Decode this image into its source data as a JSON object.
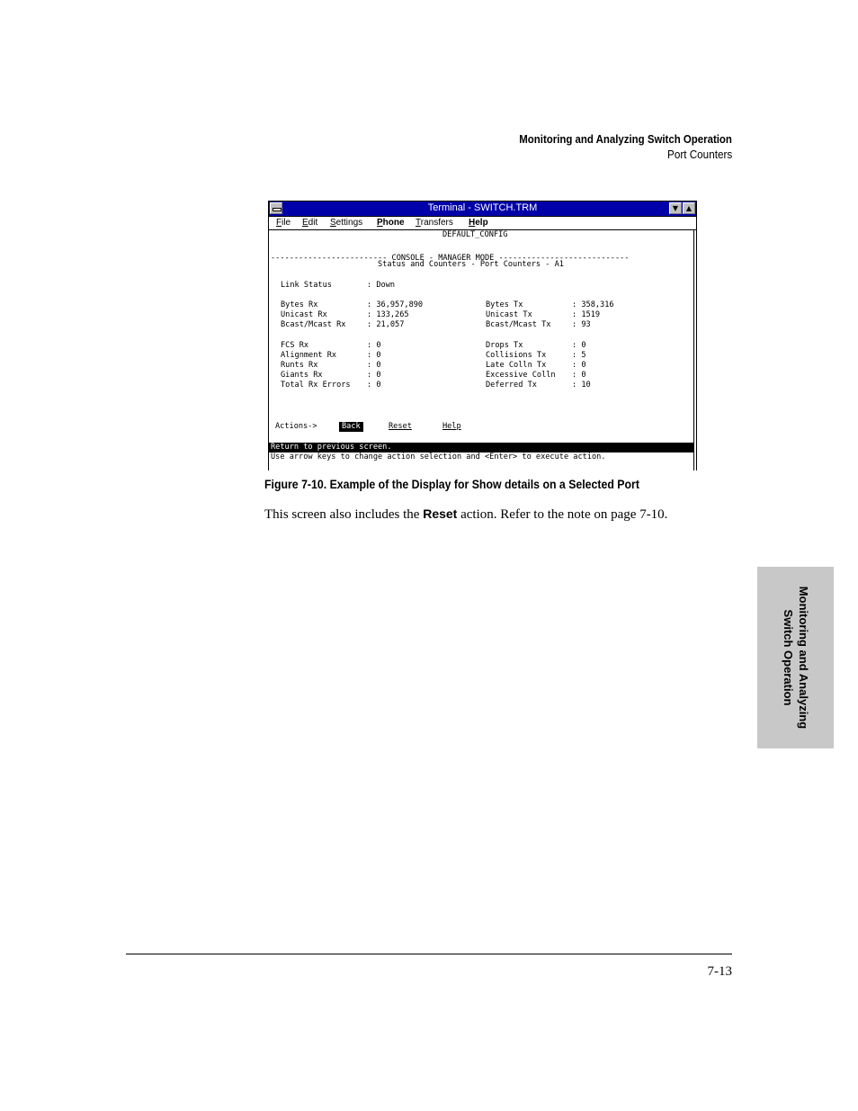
{
  "header": {
    "title": "Monitoring and Analyzing Switch Operation",
    "subtitle": "Port Counters"
  },
  "terminal": {
    "window_title": "Terminal - SWITCH.TRM",
    "menu": [
      "File",
      "Edit",
      "Settings",
      "Phone",
      "Transfers",
      "Help"
    ],
    "config_name": "DEFAULT_CONFIG",
    "mode_line": "------------------------- CONSOLE - MANAGER MODE ----------------------------",
    "screen_title": "Status and Counters - Port Counters - A1",
    "link_status_label": "Link Status",
    "link_status_value": ": Down",
    "rx_counters": [
      {
        "label": "Bytes Rx",
        "value": ": 36,957,890"
      },
      {
        "label": "Unicast Rx",
        "value": ": 133,265"
      },
      {
        "label": "Bcast/Mcast Rx",
        "value": ": 21,057"
      }
    ],
    "tx_counters": [
      {
        "label": "Bytes Tx",
        "value": ": 358,316"
      },
      {
        "label": "Unicast Tx",
        "value": ": 1519"
      },
      {
        "label": "Bcast/Mcast Tx",
        "value": ": 93"
      }
    ],
    "rx_errors": [
      {
        "label": "FCS Rx",
        "value": ": 0"
      },
      {
        "label": "Alignment Rx",
        "value": ": 0"
      },
      {
        "label": "Runts Rx",
        "value": ": 0"
      },
      {
        "label": "Giants Rx",
        "value": ": 0"
      },
      {
        "label": "Total Rx Errors",
        "value": ": 0"
      }
    ],
    "tx_errors": [
      {
        "label": "Drops Tx",
        "value": ": 0"
      },
      {
        "label": "Collisions Tx",
        "value": ": 5"
      },
      {
        "label": "Late Colln Tx",
        "value": ": 0"
      },
      {
        "label": "Excessive Colln",
        "value": ": 0"
      },
      {
        "label": "Deferred Tx",
        "value": ": 10"
      }
    ],
    "actions_label": "Actions->",
    "actions": [
      "Back",
      "Reset",
      "Help"
    ],
    "status_message": "Return to previous screen.",
    "help_message": "Use arrow keys to change action selection and <Enter> to execute action."
  },
  "caption": "Figure 7-10.  Example of the Display for Show details on a Selected Port",
  "body": {
    "before": "This screen also includes the ",
    "bold": "Reset",
    "after": " action. Refer to the note on page 7-10."
  },
  "side_tab": {
    "line1": "Monitoring and Analyzing",
    "line2": "Switch Operation"
  },
  "page_number": "7-13"
}
